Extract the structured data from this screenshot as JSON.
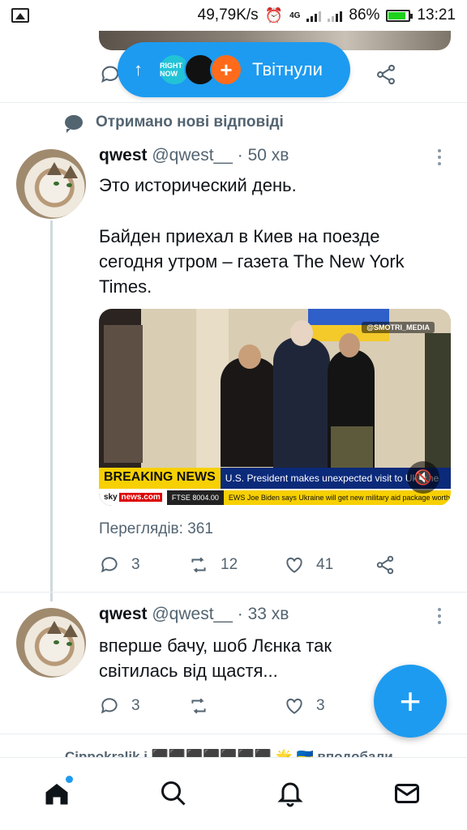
{
  "status_bar": {
    "speed": "49,79K/s",
    "network": "4G",
    "battery": "86%",
    "battery_level": 0.86,
    "time": "13:21"
  },
  "new_tweets_pill": {
    "label": "Твітнули",
    "avatars": [
      "RIGHT NOW",
      "",
      "+"
    ]
  },
  "reply_notice": "Отримано нові відповіді",
  "tweets": [
    {
      "name": "qwest",
      "handle": "@qwest__",
      "time": "· 50 хв",
      "text_line1": "Это исторический день.",
      "text_line2": "Байден приехал в Киев на поезде сегодня утром – газета The New York Times.",
      "media": {
        "source_tag": "@SMOTRI_MEDIA",
        "breaking": "BREAKING NEWS",
        "headline": "U.S. President makes unexpected visit to Ukraine",
        "channel": "news.com",
        "channel_prefix": "sky",
        "ftse": "FTSE 8004.00",
        "scroll_text": "EWS   Joe Biden says Ukraine will get new military aid package worth"
      },
      "views": "Переглядів: 361",
      "replies": "3",
      "retweets": "12",
      "likes": "41"
    },
    {
      "name": "qwest",
      "handle": "@qwest__",
      "time": "· 33 хв",
      "text": "вперше бачу, шоб Лєнка так світилась від щастя...",
      "replies": "3",
      "retweets": "",
      "likes": "3"
    }
  ],
  "next_peek": "Cippokralik і ⬛⬛⬛⬛⬛⬛⬛ 🌟 🇺🇦 вподобали",
  "fab_label": "+",
  "colors": {
    "accent": "#1d9bf0",
    "muted": "#536471"
  }
}
